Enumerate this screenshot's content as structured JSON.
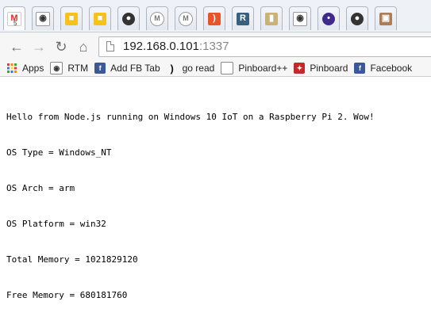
{
  "tabs": [
    {
      "icon": "gmail-icon",
      "badge": "5"
    },
    {
      "icon": "rtm-cow-icon"
    },
    {
      "icon": "yellow-box-icon"
    },
    {
      "icon": "yellow-box-icon"
    },
    {
      "icon": "github-icon"
    },
    {
      "icon": "circle-m-icon"
    },
    {
      "icon": "circle-m-icon"
    },
    {
      "icon": "rss-icon"
    },
    {
      "icon": "r-icon",
      "label": "R"
    },
    {
      "icon": "bookmark-icon"
    },
    {
      "icon": "rtm-cow-icon"
    },
    {
      "icon": "blue-circle-icon"
    },
    {
      "icon": "github-icon"
    },
    {
      "icon": "photo-icon"
    }
  ],
  "toolbar": {
    "url_host": "192.168.0.101",
    "url_port": ":1337"
  },
  "bookmarks": [
    {
      "label": "Apps",
      "icon": "apps-grid-icon"
    },
    {
      "label": "RTM",
      "icon": "rtm-cow-icon"
    },
    {
      "label": "Add FB Tab",
      "icon": "facebook-icon"
    },
    {
      "label": "go read",
      "icon": "rss-icon"
    },
    {
      "label": "Pinboard++",
      "icon": "page-icon"
    },
    {
      "label": "Pinboard",
      "icon": "pinboard-pin-icon"
    },
    {
      "label": "Facebook",
      "icon": "facebook-icon"
    }
  ],
  "content": {
    "lines": [
      "Hello from Node.js running on Windows 10 IoT on a Raspberry Pi 2. Wow!",
      "OS Type = Windows_NT",
      "OS Arch = arm",
      "OS Platform = win32",
      "Total Memory = 1021829120",
      "Free Memory = 680181760"
    ]
  },
  "colors": {
    "tabstrip": "#eef1f6",
    "toolbar": "#f6f6f6",
    "facebook": "#3b5998",
    "gmail_red": "#d93025"
  }
}
